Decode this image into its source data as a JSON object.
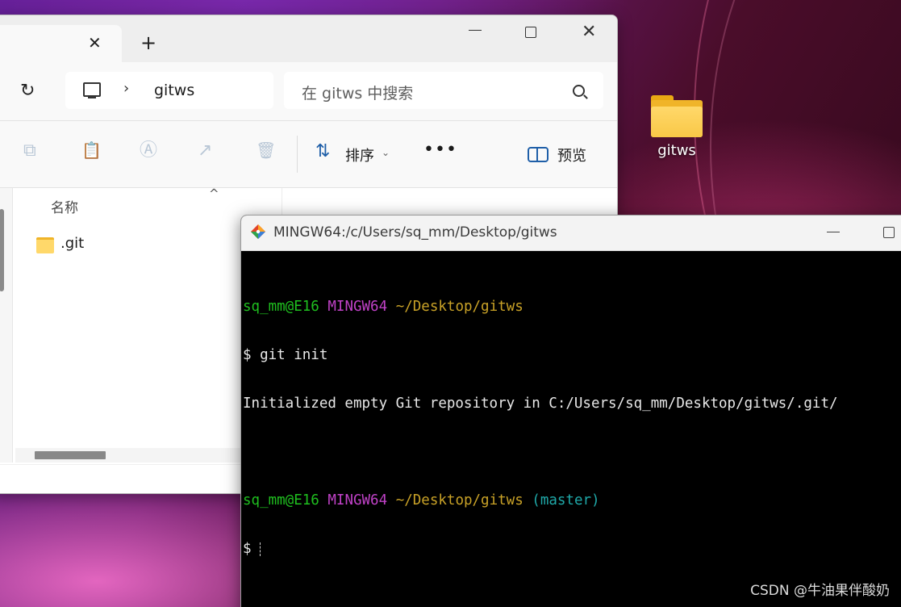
{
  "desktop": {
    "folder_label": "gitws"
  },
  "explorer": {
    "tab": {
      "close_glyph": "✕",
      "new_tab_glyph": "+"
    },
    "window_controls": {
      "close_glyph": "✕"
    },
    "nav": {
      "refresh_glyph": "↻",
      "breadcrumb_chevron": "›",
      "address_text": "gitws",
      "search_placeholder": "在 gitws 中搜索"
    },
    "toolbar": {
      "copy_glyph": "⧉",
      "paste_glyph": "📋",
      "rename_glyph": "Ⓐ",
      "share_glyph": "↗",
      "delete_glyph": "🗑",
      "sort_glyph": "⇅",
      "sort_label": "排序",
      "sort_chevron": "⌄",
      "more_glyph": "•••",
      "preview_label": "预览"
    },
    "list": {
      "column_name": "名称",
      "sort_caret": "^",
      "items": [
        {
          "name": ".git",
          "icon": "folder-icon"
        }
      ]
    }
  },
  "terminal": {
    "title": "MINGW64:/c/Users/sq_mm/Desktop/gitws",
    "colors": {
      "background": "#000000",
      "user_host": "#1fbf1f",
      "shell": "#c142c8",
      "path": "#c9a227",
      "branch": "#1fa9a9",
      "text": "#e8e8e8"
    },
    "lines": {
      "prompt1_user": "sq_mm@E16",
      "prompt1_shell": "MINGW64",
      "prompt1_path": "~/Desktop/gitws",
      "cmd1": "$ git init",
      "output1": "Initialized empty Git repository in C:/Users/sq_mm/Desktop/gitws/.git/",
      "prompt2_user": "sq_mm@E16",
      "prompt2_shell": "MINGW64",
      "prompt2_path": "~/Desktop/gitws",
      "prompt2_branch": "(master)",
      "cmd2": "$ "
    }
  },
  "watermark": "CSDN @牛油果伴酸奶"
}
